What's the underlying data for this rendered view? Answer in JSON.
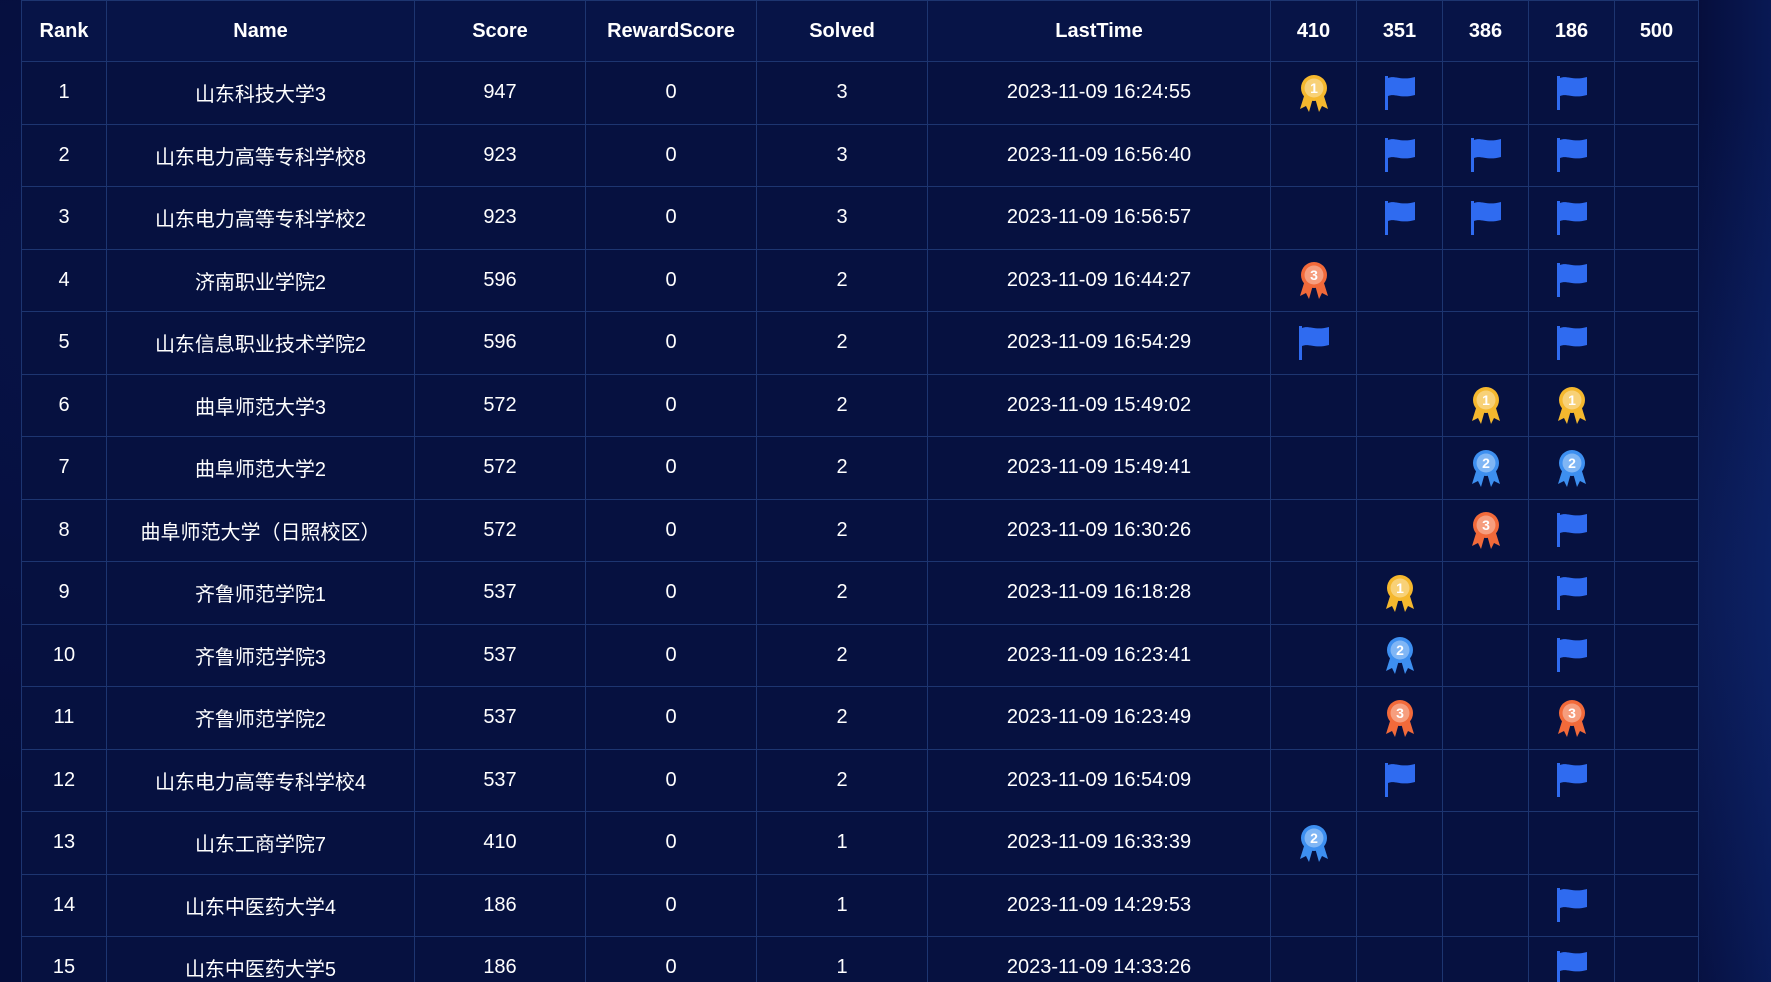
{
  "columns": [
    "Rank",
    "Name",
    "Score",
    "RewardScore",
    "Solved",
    "LastTime",
    "410",
    "351",
    "386",
    "186",
    "500"
  ],
  "rows": [
    {
      "rank": "1",
      "name": "山东科技大学3",
      "score": "947",
      "reward": "0",
      "solved": "3",
      "time": "2023-11-09 16:24:55",
      "problems": [
        "medal-gold",
        "flag",
        "",
        "flag",
        ""
      ]
    },
    {
      "rank": "2",
      "name": "山东电力高等专科学校8",
      "score": "923",
      "reward": "0",
      "solved": "3",
      "time": "2023-11-09 16:56:40",
      "problems": [
        "",
        "flag",
        "flag",
        "flag",
        ""
      ]
    },
    {
      "rank": "3",
      "name": "山东电力高等专科学校2",
      "score": "923",
      "reward": "0",
      "solved": "3",
      "time": "2023-11-09 16:56:57",
      "problems": [
        "",
        "flag",
        "flag",
        "flag",
        ""
      ]
    },
    {
      "rank": "4",
      "name": "济南职业学院2",
      "score": "596",
      "reward": "0",
      "solved": "2",
      "time": "2023-11-09 16:44:27",
      "problems": [
        "medal-bronze",
        "",
        "",
        "flag",
        ""
      ]
    },
    {
      "rank": "5",
      "name": "山东信息职业技术学院2",
      "score": "596",
      "reward": "0",
      "solved": "2",
      "time": "2023-11-09 16:54:29",
      "problems": [
        "flag",
        "",
        "",
        "flag",
        ""
      ]
    },
    {
      "rank": "6",
      "name": "曲阜师范大学3",
      "score": "572",
      "reward": "0",
      "solved": "2",
      "time": "2023-11-09 15:49:02",
      "problems": [
        "",
        "",
        "medal-gold",
        "medal-gold",
        ""
      ]
    },
    {
      "rank": "7",
      "name": "曲阜师范大学2",
      "score": "572",
      "reward": "0",
      "solved": "2",
      "time": "2023-11-09 15:49:41",
      "problems": [
        "",
        "",
        "medal-silver",
        "medal-silver",
        ""
      ]
    },
    {
      "rank": "8",
      "name": "曲阜师范大学（日照校区）",
      "score": "572",
      "reward": "0",
      "solved": "2",
      "time": "2023-11-09 16:30:26",
      "problems": [
        "",
        "",
        "medal-bronze",
        "flag",
        ""
      ]
    },
    {
      "rank": "9",
      "name": "齐鲁师范学院1",
      "score": "537",
      "reward": "0",
      "solved": "2",
      "time": "2023-11-09 16:18:28",
      "problems": [
        "",
        "medal-gold",
        "",
        "flag",
        ""
      ]
    },
    {
      "rank": "10",
      "name": "齐鲁师范学院3",
      "score": "537",
      "reward": "0",
      "solved": "2",
      "time": "2023-11-09 16:23:41",
      "problems": [
        "",
        "medal-silver",
        "",
        "flag",
        ""
      ]
    },
    {
      "rank": "11",
      "name": "齐鲁师范学院2",
      "score": "537",
      "reward": "0",
      "solved": "2",
      "time": "2023-11-09 16:23:49",
      "problems": [
        "",
        "medal-bronze",
        "",
        "medal-bronze",
        ""
      ]
    },
    {
      "rank": "12",
      "name": "山东电力高等专科学校4",
      "score": "537",
      "reward": "0",
      "solved": "2",
      "time": "2023-11-09 16:54:09",
      "problems": [
        "",
        "flag",
        "",
        "flag",
        ""
      ]
    },
    {
      "rank": "13",
      "name": "山东工商学院7",
      "score": "410",
      "reward": "0",
      "solved": "1",
      "time": "2023-11-09 16:33:39",
      "problems": [
        "medal-silver",
        "",
        "",
        "",
        ""
      ]
    },
    {
      "rank": "14",
      "name": "山东中医药大学4",
      "score": "186",
      "reward": "0",
      "solved": "1",
      "time": "2023-11-09 14:29:53",
      "problems": [
        "",
        "",
        "",
        "flag",
        ""
      ]
    },
    {
      "rank": "15",
      "name": "山东中医药大学5",
      "score": "186",
      "reward": "0",
      "solved": "1",
      "time": "2023-11-09 14:33:26",
      "problems": [
        "",
        "",
        "",
        "flag",
        ""
      ]
    }
  ],
  "icons": {
    "flag": {
      "color": "#2f6bf0",
      "name": "flag-icon"
    },
    "medal-gold": {
      "color": "#f5b82e",
      "number": "1",
      "name": "gold-medal-icon"
    },
    "medal-silver": {
      "color": "#3d8ff0",
      "number": "2",
      "name": "silver-medal-icon"
    },
    "medal-bronze": {
      "color": "#f26a3a",
      "number": "3",
      "name": "bronze-medal-icon"
    }
  },
  "colors": {
    "background": "#050d3a",
    "grid": "#1d3570",
    "text": "#ffffff"
  }
}
